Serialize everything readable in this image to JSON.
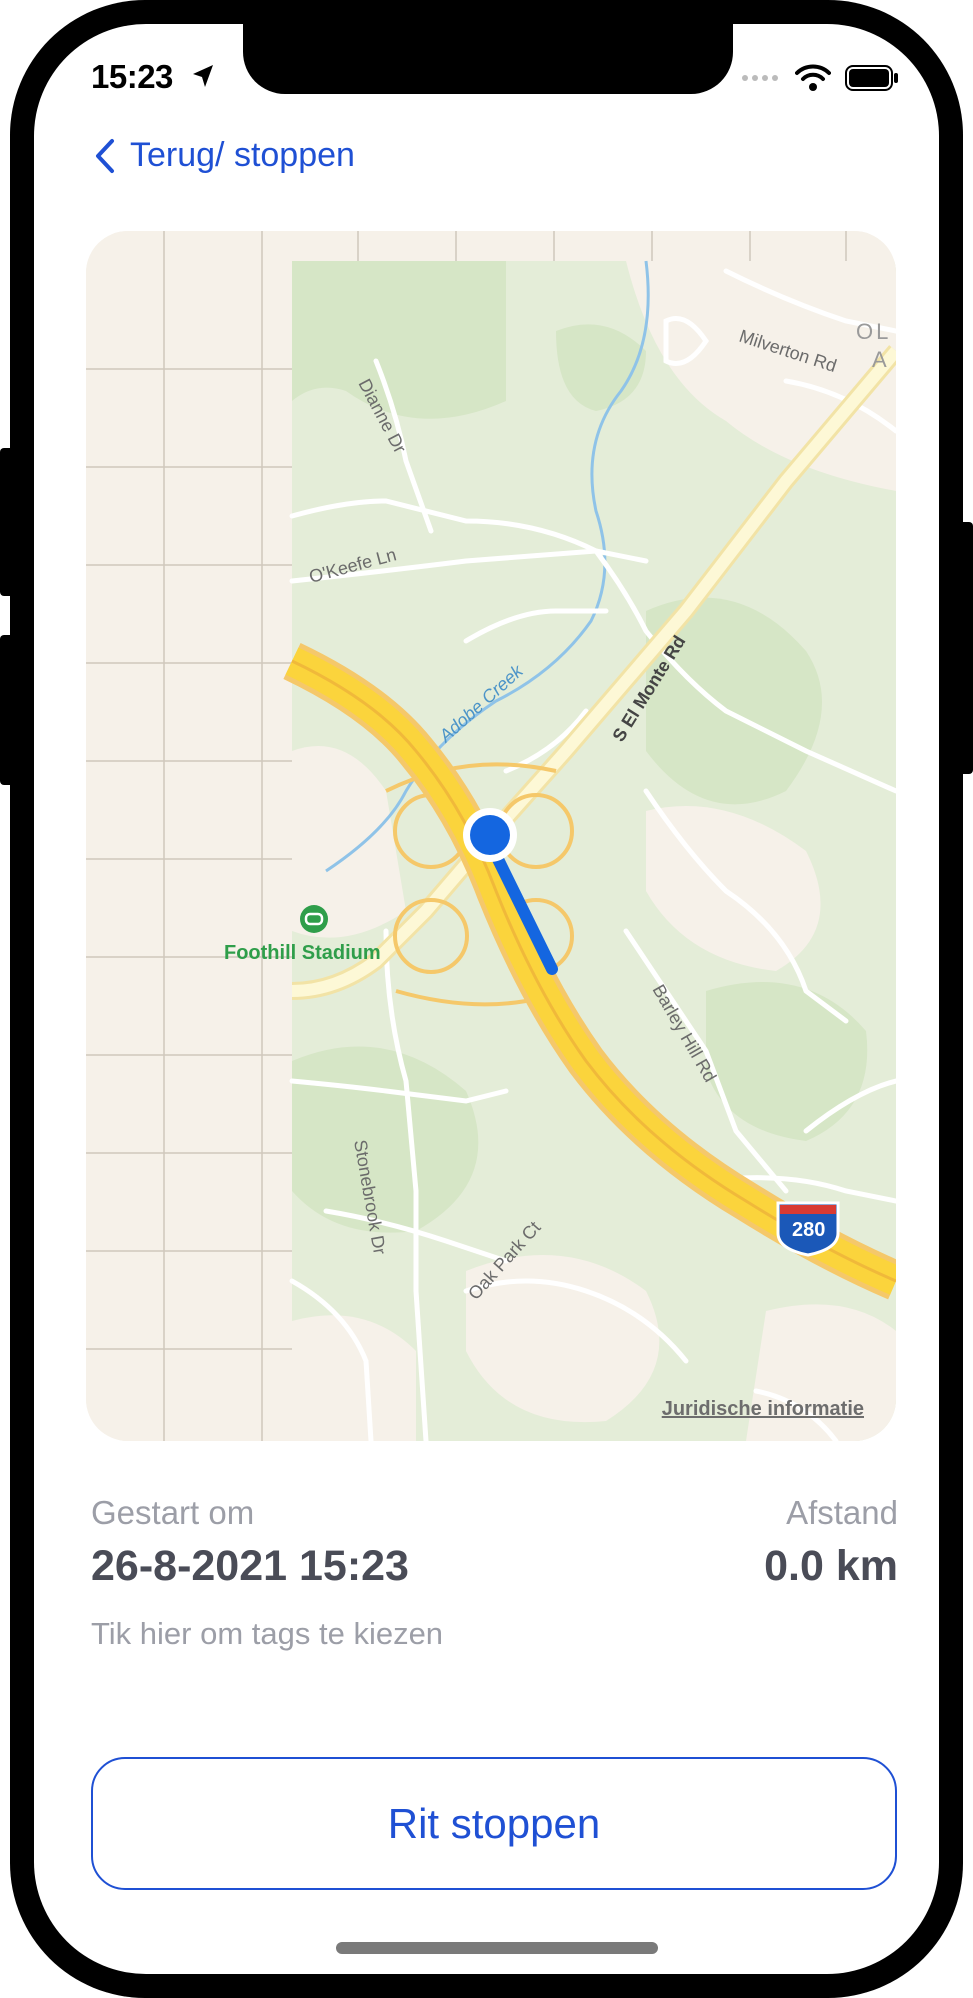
{
  "status_bar": {
    "time": "15:23"
  },
  "nav": {
    "back_label": "Terug/ stoppen"
  },
  "map": {
    "legal_link": "Juridische informatie",
    "labels": {
      "road_milverton": "Milverton Rd",
      "road_dianne": "Dianne Dr",
      "road_okeefe": "O'Keefe Ln",
      "creek": "Adobe Creek",
      "road_el_monte": "S El Monte Rd",
      "poi_stadium": "Foothill Stadium",
      "road_barley": "Barley Hill Rd",
      "road_stonebrook": "Stonebrook Dr",
      "road_oak_park": "Oak Park Ct",
      "highway_shield": "280",
      "edge_label_1": "OL",
      "edge_label_2": "A"
    }
  },
  "trip": {
    "start_label": "Gestart om",
    "start_value": "26-8-2021 15:23",
    "distance_label": "Afstand",
    "distance_value": "0.0 km",
    "tags_hint": "Tik hier om tags te kiezen"
  },
  "actions": {
    "stop_label": "Rit stoppen"
  },
  "colors": {
    "accent": "#1f50d4",
    "muted": "#9c9ea7",
    "value": "#4a4c57",
    "route": "#1466e0"
  }
}
